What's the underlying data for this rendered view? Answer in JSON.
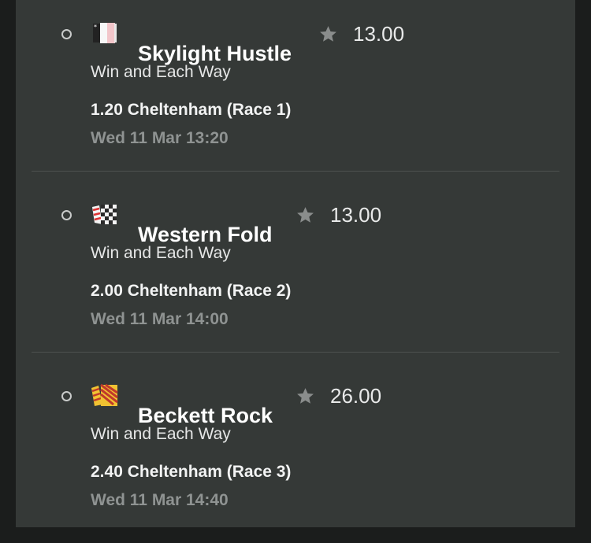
{
  "selections": [
    {
      "horse": "Skylight Hustle",
      "odds": "13.00",
      "market": "Win and Each Way",
      "race": "1.20 Cheltenham (Race 1)",
      "datetime": "Wed 11 Mar 13:20",
      "silk_icon": "silk-white-pink-icon"
    },
    {
      "horse": "Western Fold",
      "odds": "13.00",
      "market": "Win and Each Way",
      "race": "2.00 Cheltenham (Race 2)",
      "datetime": "Wed 11 Mar 14:00",
      "silk_icon": "silk-checked-icon"
    },
    {
      "horse": "Beckett Rock",
      "odds": "26.00",
      "market": "Win and Each Way",
      "race": "2.40 Cheltenham (Race 3)",
      "datetime": "Wed 11 Mar 14:40",
      "silk_icon": "silk-striped-icon"
    }
  ],
  "colors": {
    "panel": "#353937",
    "background": "#1b1d1c",
    "star": "#8a8d8c",
    "muted_text": "#8f9392"
  },
  "icons": {
    "radio": "radio-icon",
    "favourite": "star-icon"
  }
}
